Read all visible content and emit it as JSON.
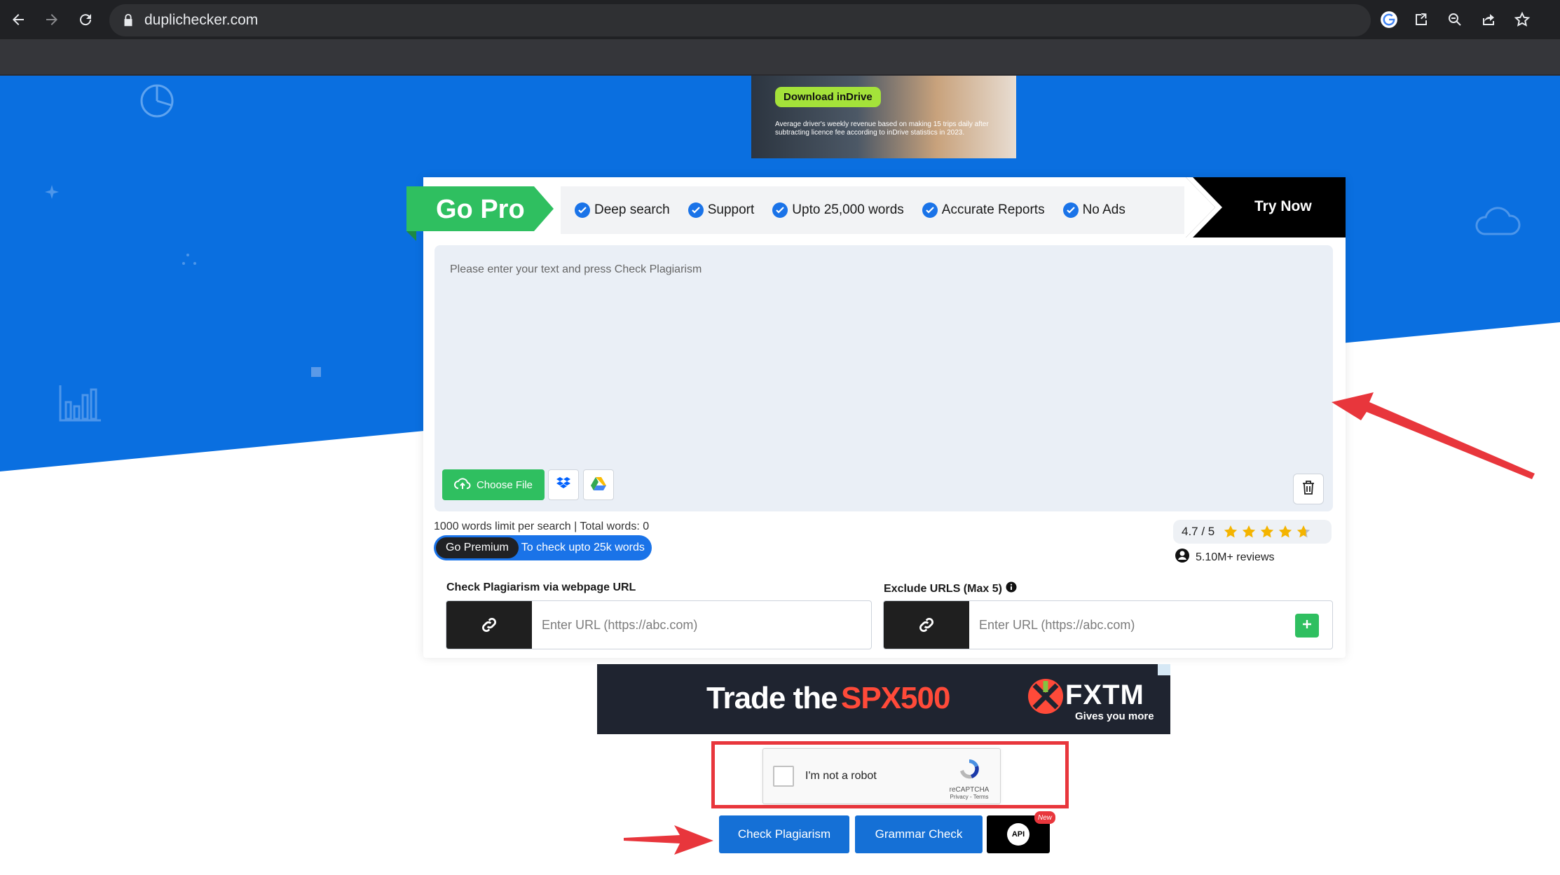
{
  "browser": {
    "url": "duplichecker.com"
  },
  "ad_top": {
    "button": "Download inDrive",
    "small_text": "Average driver's weekly revenue based on making 15 trips daily after subtracting licence fee according to inDrive statistics in 2023."
  },
  "gopro": {
    "label": "Go Pro",
    "features": [
      "Deep search",
      "Support",
      "Upto 25,000 words",
      "Accurate Reports",
      "No Ads"
    ],
    "try_now": "Try Now"
  },
  "editor": {
    "placeholder": "Please enter your text and press Check Plagiarism",
    "choose_file": "Choose File",
    "limit_text": "1000 words limit per search | Total words: 0",
    "premium_pill": "Go Premium",
    "premium_text": "To check upto 25k words"
  },
  "rating": {
    "score": "4.7 / 5",
    "stars_value": 4.7,
    "reviews": "5.10M+ reviews"
  },
  "url_check": {
    "label": "Check Plagiarism via webpage URL",
    "placeholder": "Enter URL (https://abc.com)"
  },
  "exclude": {
    "label": "Exclude URLS (Max 5)",
    "placeholder": "Enter URL (https://abc.com)"
  },
  "ad_fx": {
    "text1": "Trade the",
    "text2": "SPX500",
    "brand": "FXTM",
    "sub": "Gives you more"
  },
  "captcha": {
    "label": "I'm not a robot",
    "brand": "reCAPTCHA",
    "links": "Privacy - Terms"
  },
  "actions": {
    "check": "Check Plagiarism",
    "grammar": "Grammar Check",
    "api": "API",
    "new_badge": "New"
  },
  "colors": {
    "hero_blue": "#0a6fe0",
    "green": "#2fbf60",
    "annotation_red": "#e8363c"
  }
}
